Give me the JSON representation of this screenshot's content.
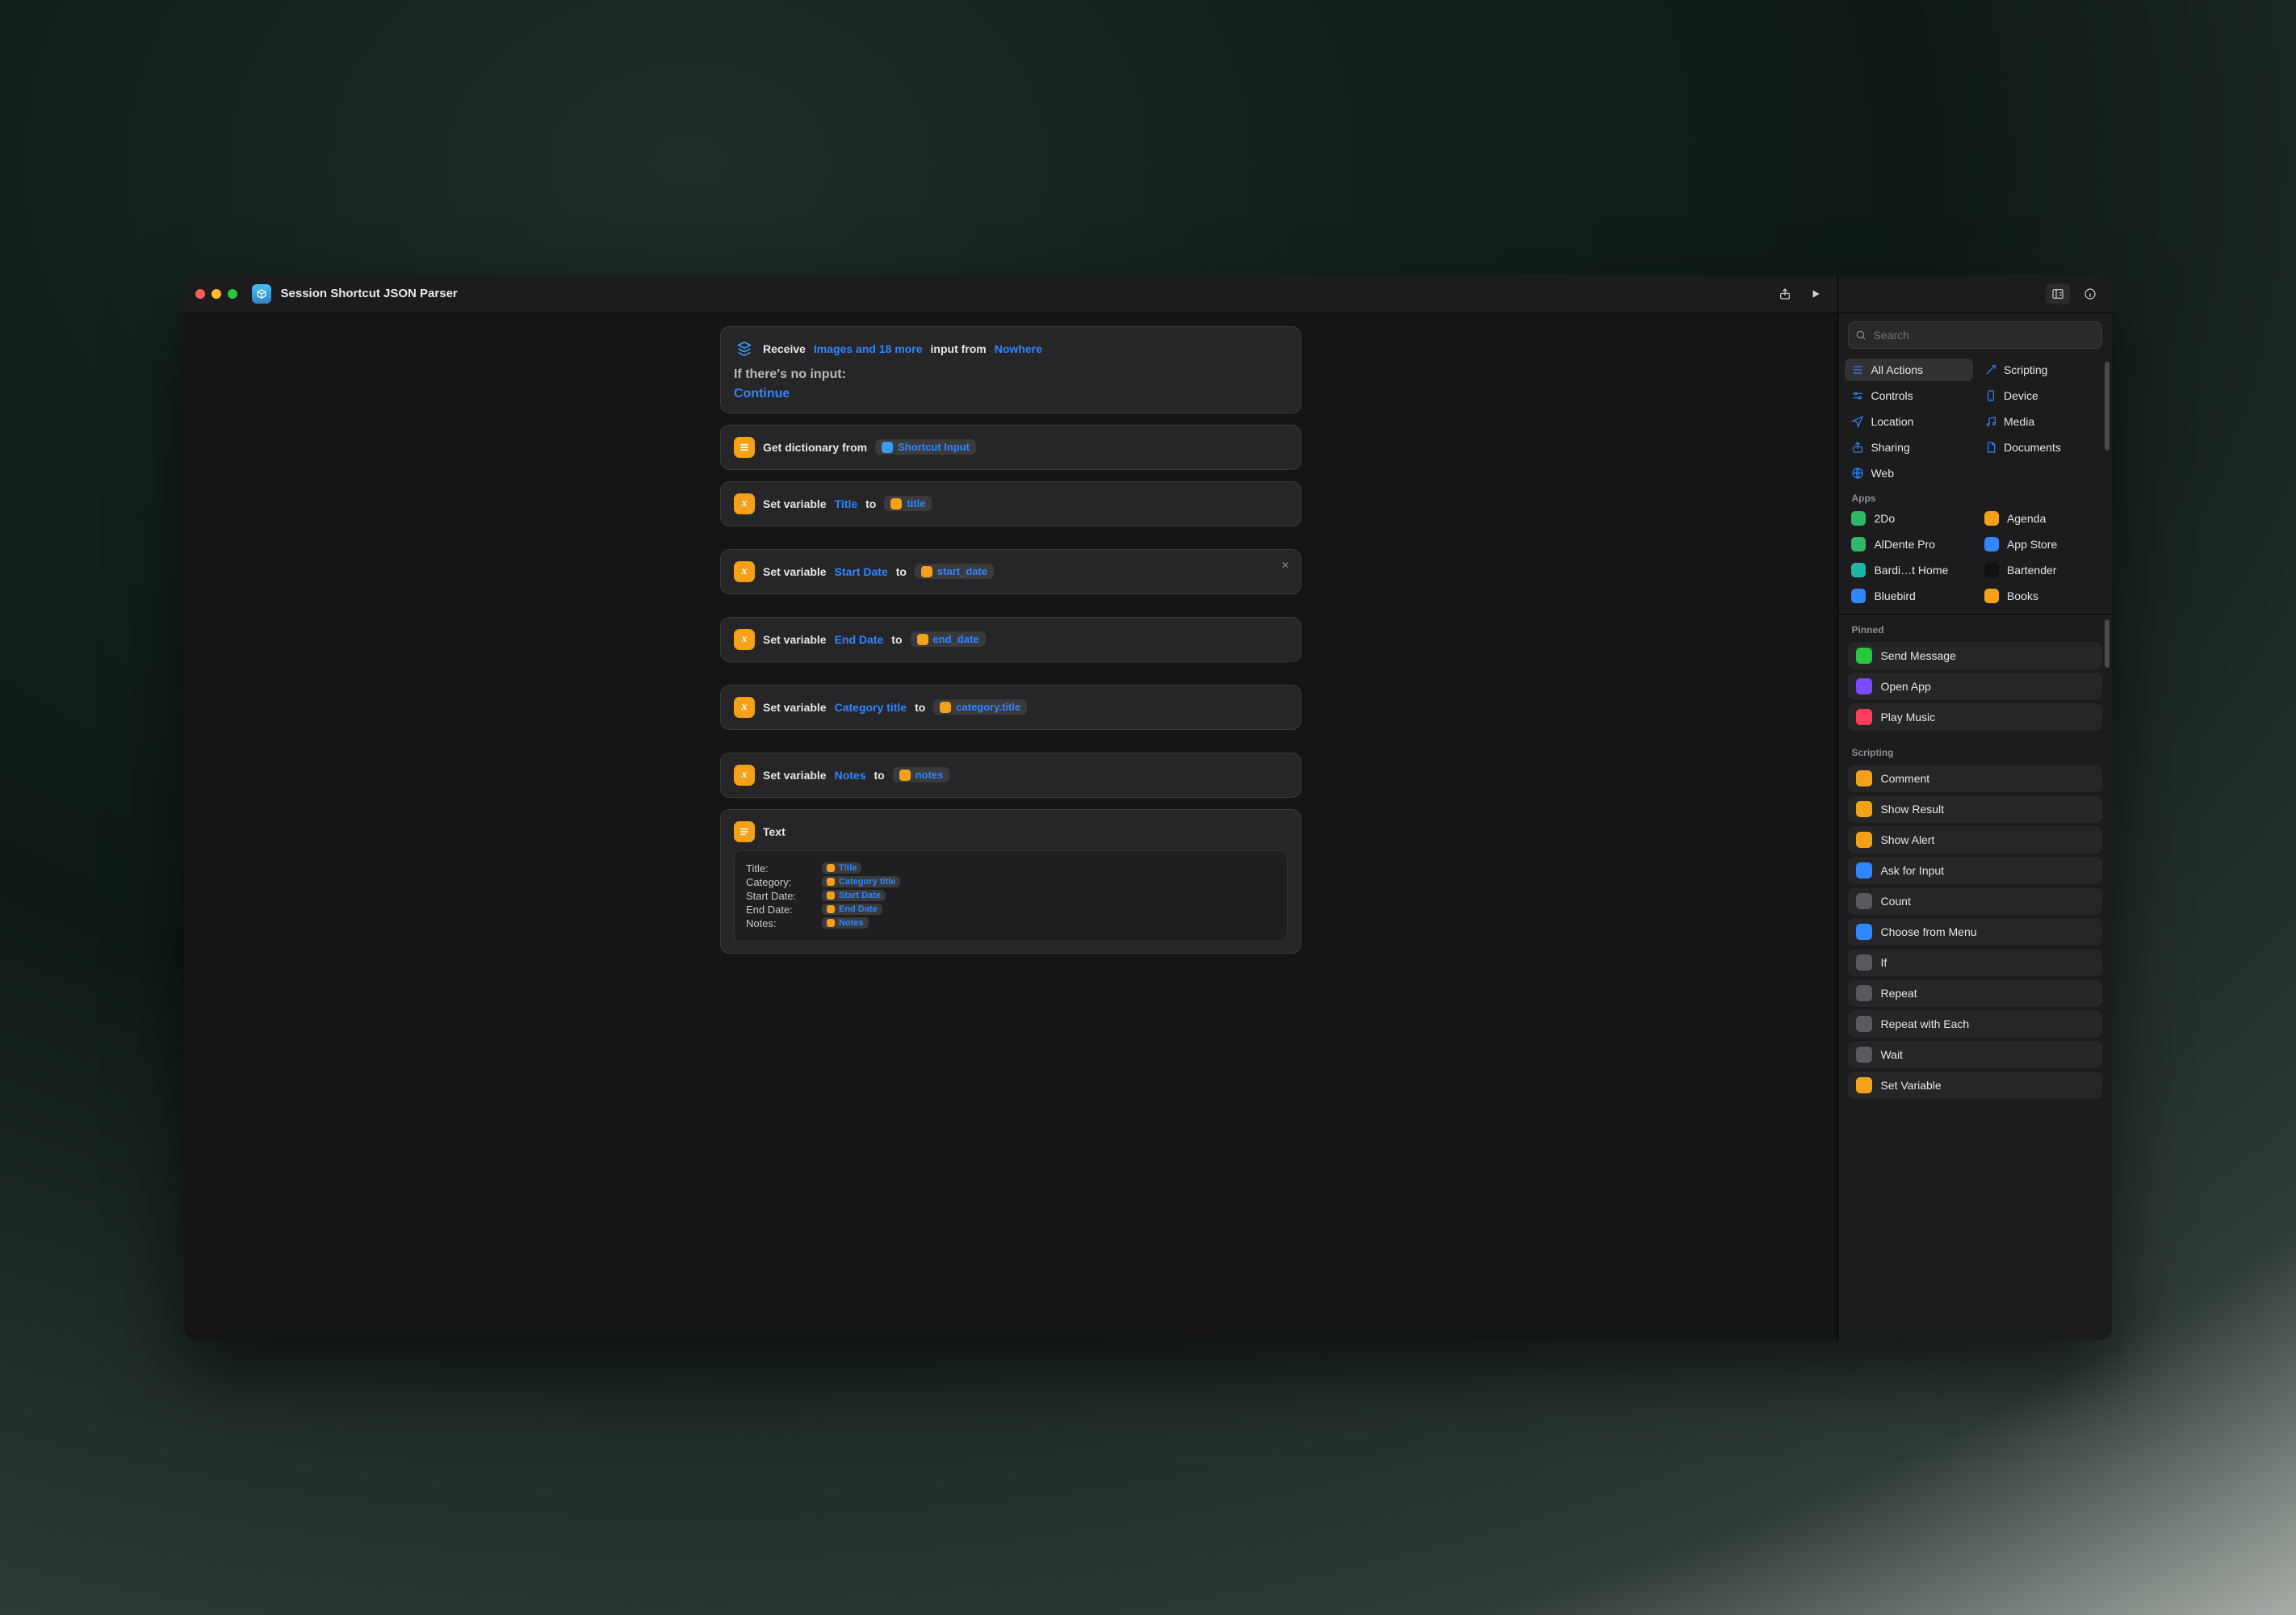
{
  "window": {
    "title": "Session Shortcut JSON Parser"
  },
  "colors": {
    "accent": "#2f86ff",
    "orange": "#f4a11a",
    "bg_card": "#262628"
  },
  "search": {
    "placeholder": "Search"
  },
  "input_card": {
    "receive": "Receive",
    "types": "Images and 18 more",
    "from": "input from",
    "source": "Nowhere",
    "no_input_label": "If there's no input:",
    "continue": "Continue"
  },
  "get_dict": {
    "label": "Get dictionary from",
    "value": "Shortcut Input"
  },
  "set_vars": [
    {
      "label": "Set variable",
      "name": "Title",
      "to": "to",
      "value": "title"
    },
    {
      "label": "Set variable",
      "name": "Start Date",
      "to": "to",
      "value": "start_date",
      "closable": true
    },
    {
      "label": "Set variable",
      "name": "End Date",
      "to": "to",
      "value": "end_date"
    },
    {
      "label": "Set variable",
      "name": "Category title",
      "to": "to",
      "value": "category.title"
    },
    {
      "label": "Set variable",
      "name": "Notes",
      "to": "to",
      "value": "notes"
    }
  ],
  "text_card": {
    "title": "Text",
    "lines": [
      {
        "label": "Title:",
        "token": "Title"
      },
      {
        "label": "Category:",
        "token": "Category title"
      },
      {
        "label": "Start Date:",
        "token": "Start Date"
      },
      {
        "label": "End Date:",
        "token": "End Date"
      },
      {
        "label": "Notes:",
        "token": "Notes"
      }
    ]
  },
  "categories": [
    {
      "name": "All Actions",
      "active": true,
      "icon": "list"
    },
    {
      "name": "Scripting",
      "icon": "wand"
    },
    {
      "name": "Controls",
      "icon": "sliders"
    },
    {
      "name": "Device",
      "icon": "phone"
    },
    {
      "name": "Location",
      "icon": "nav"
    },
    {
      "name": "Media",
      "icon": "note"
    },
    {
      "name": "Sharing",
      "icon": "share"
    },
    {
      "name": "Documents",
      "icon": "doc"
    },
    {
      "name": "Web",
      "icon": "globe"
    }
  ],
  "apps_header": "Apps",
  "apps": [
    {
      "name": "2Do",
      "color": "#2fb86a"
    },
    {
      "name": "Agenda",
      "color": "#f4a11a"
    },
    {
      "name": "AlDente Pro",
      "color": "#2fb86a"
    },
    {
      "name": "App Store",
      "color": "#2f86ff"
    },
    {
      "name": "Bardi…t Home",
      "color": "#1fb6a9"
    },
    {
      "name": "Bartender",
      "color": "#111111"
    },
    {
      "name": "Bluebird",
      "color": "#2f86ff"
    },
    {
      "name": "Books",
      "color": "#f4a11a"
    }
  ],
  "pinned_header": "Pinned",
  "pinned": [
    {
      "name": "Send Message",
      "color": "#28c840"
    },
    {
      "name": "Open App",
      "color": "#7a4bff"
    },
    {
      "name": "Play Music",
      "color": "#ff3b5b"
    }
  ],
  "scripting_header": "Scripting",
  "scripting_actions": [
    {
      "name": "Comment",
      "color": "#f4a11a"
    },
    {
      "name": "Show Result",
      "color": "#f4a11a"
    },
    {
      "name": "Show Alert",
      "color": "#f4a11a"
    },
    {
      "name": "Ask for Input",
      "color": "#2f86ff"
    },
    {
      "name": "Count",
      "color": "#5a5a5e"
    },
    {
      "name": "Choose from Menu",
      "color": "#2f86ff"
    },
    {
      "name": "If",
      "color": "#5a5a5e"
    },
    {
      "name": "Repeat",
      "color": "#5a5a5e"
    },
    {
      "name": "Repeat with Each",
      "color": "#5a5a5e"
    },
    {
      "name": "Wait",
      "color": "#5a5a5e"
    },
    {
      "name": "Set Variable",
      "color": "#f4a11a"
    }
  ]
}
